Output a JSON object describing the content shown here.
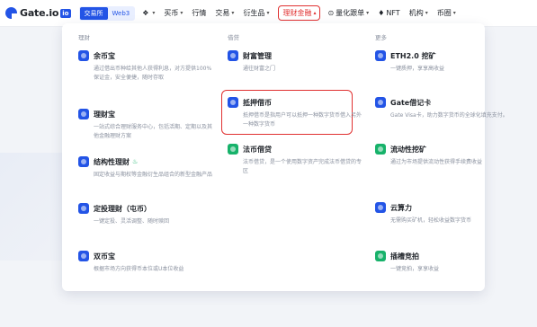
{
  "brand": {
    "name": "Gate.io",
    "badge": "io"
  },
  "mode_switch": {
    "exchange": "交易所",
    "web3": "Web3"
  },
  "nav": [
    {
      "label": "",
      "icon": "apps-grid-icon",
      "caret": true
    },
    {
      "label": "买币",
      "caret": true
    },
    {
      "label": "行情",
      "caret": false
    },
    {
      "label": "交易",
      "caret": true
    },
    {
      "label": "衍生品",
      "caret": true
    },
    {
      "label": "理财金融",
      "caret": true,
      "highlighted": true
    },
    {
      "label": "量化跟单",
      "icon": "robot-icon",
      "caret": true
    },
    {
      "label": "NFT",
      "icon": "diamond-icon",
      "caret": false
    },
    {
      "label": "机构",
      "caret": true
    },
    {
      "label": "币圈",
      "caret": true
    }
  ],
  "dropdown": {
    "columns": [
      {
        "heading": "理财",
        "items": [
          {
            "title": "余币宝",
            "icon": "coin-savings-icon",
            "color": "#2354e6",
            "desc": "通过借出币种给其他人获得利息，对方提供100%保证金，安全便捷，随时存取"
          },
          {
            "title": "理财宝",
            "icon": "wallet-icon",
            "color": "#2354e6",
            "desc": "一站式综合理财服务中心，包括活期、定期以及其他金融理财方案"
          },
          {
            "title": "结构性理财",
            "icon": "structured-product-icon",
            "color": "#2354e6",
            "badge": "hot-icon",
            "desc": "固定收益与期权等金融衍生品组合的新型金融产品"
          },
          {
            "title": "定投理财（屯币）",
            "icon": "calendar-icon",
            "color": "#2354e6",
            "desc": "一键定投、灵活调整、随时赎回"
          },
          {
            "title": "双币宝",
            "icon": "dual-currency-icon",
            "color": "#2354e6",
            "desc": "根据市场方向获得币本位或U本位收益"
          }
        ]
      },
      {
        "heading": "借贷",
        "items": [
          {
            "title": "财富管理",
            "icon": "wealth-icon",
            "color": "#2354e6",
            "desc": "通往财富之门"
          },
          {
            "title": "抵押借币",
            "icon": "pledge-loan-icon",
            "color": "#2354e6",
            "desc": "抵押借币是指用户可以抵押一种数字货币借入另外一种数字货币"
          },
          {
            "title": "法币借贷",
            "icon": "fiat-loan-icon",
            "color": "#17b26a",
            "desc": "法币借贷，是一个使用数字资产完成法币借贷的专区"
          }
        ]
      },
      {
        "heading": "更多",
        "items": [
          {
            "title": "ETH2.0 挖矿",
            "icon": "eth-icon",
            "color": "#2354e6",
            "desc": "一键质押，享享高收益"
          },
          {
            "title": "Gate借记卡",
            "icon": "card-icon",
            "color": "#2354e6",
            "desc": "Gate Visa卡，助力数字货币的全球化填充支付。"
          },
          {
            "title": "流动性挖矿",
            "icon": "liquidity-icon",
            "color": "#17b26a",
            "desc": "通过为市场提供流动性获得手续费收益"
          },
          {
            "title": "云算力",
            "icon": "cloud-mining-icon",
            "color": "#2354e6",
            "desc": "无需购买矿机，轻松收益数字货币"
          },
          {
            "title": "插槽竞拍",
            "icon": "auction-icon",
            "color": "#17b26a",
            "desc": "一键竞拍，享享收益"
          }
        ]
      }
    ]
  }
}
